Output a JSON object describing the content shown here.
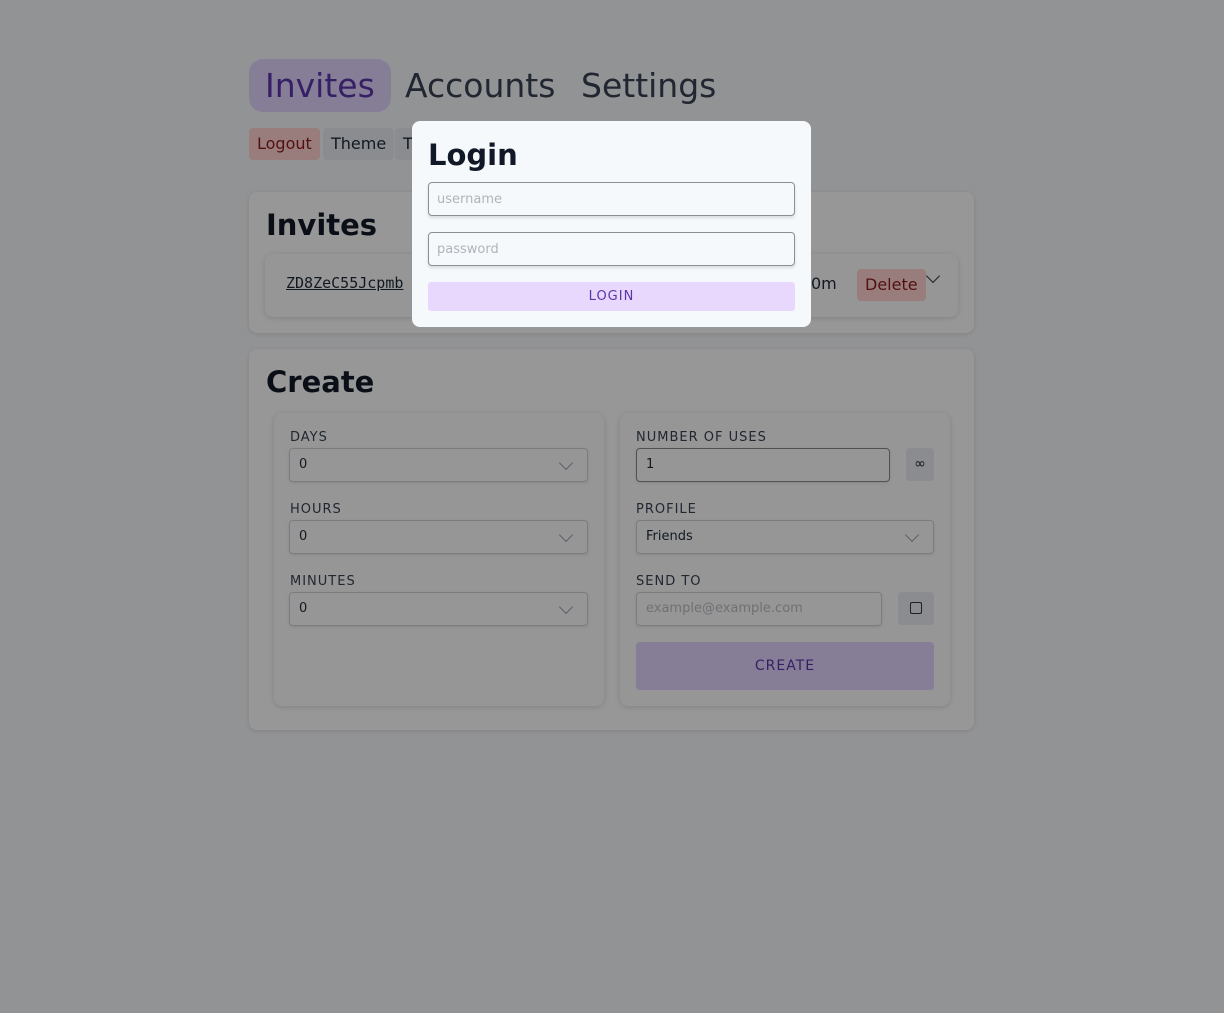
{
  "tabs": [
    "Invites",
    "Accounts",
    "Settings"
  ],
  "top_buttons": {
    "logout": "Logout",
    "theme": "Theme",
    "third": "T"
  },
  "invites": {
    "title": "Invites",
    "code": "ZD8ZeC55Jcpmb",
    "expiry_partial": "0m",
    "delete": "Delete"
  },
  "create": {
    "title": "Create",
    "days": {
      "label": "DAYS",
      "value": "0"
    },
    "hours": {
      "label": "HOURS",
      "value": "0"
    },
    "minutes": {
      "label": "MINUTES",
      "value": "0"
    },
    "uses": {
      "label": "NUMBER OF USES",
      "value": "1",
      "infinity": "∞"
    },
    "profile": {
      "label": "PROFILE",
      "value": "Friends"
    },
    "send_to": {
      "label": "SEND TO",
      "placeholder": "example@example.com"
    },
    "create_button": "CREATE"
  },
  "login": {
    "title": "Login",
    "username_placeholder": "username",
    "password_placeholder": "password",
    "button": "LOGIN"
  },
  "colors": {
    "accent": "#e0d2fb",
    "danger": "#fecaca"
  }
}
